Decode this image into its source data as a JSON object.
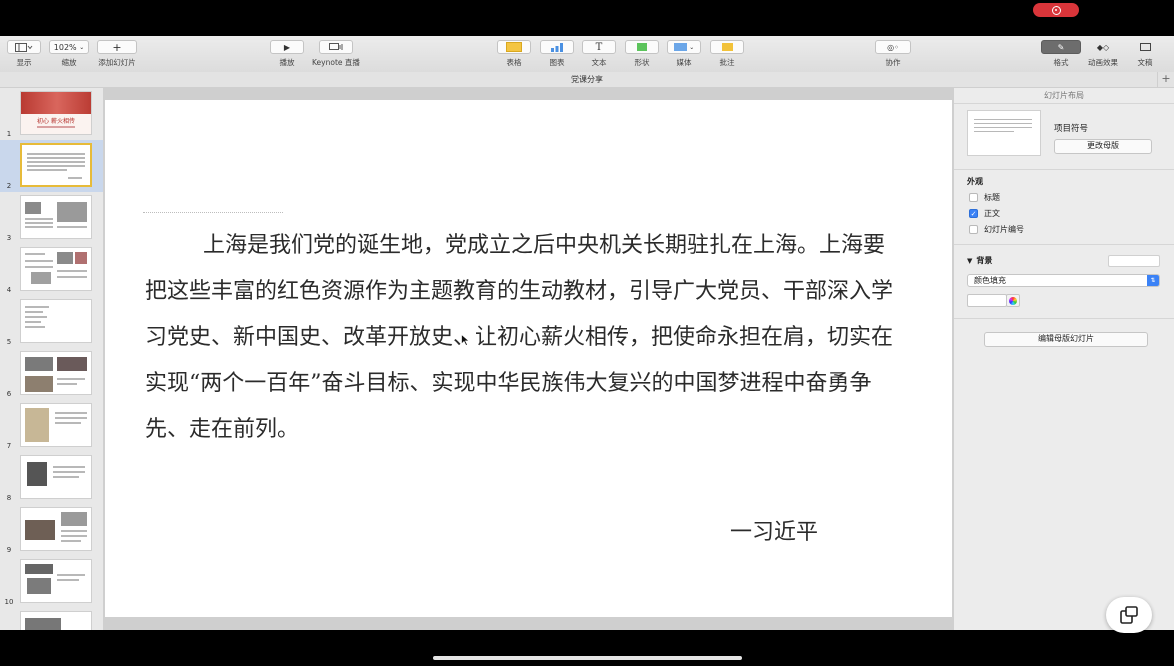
{
  "app": {
    "document_title": "党课分享"
  },
  "toolbar": {
    "view": {
      "label": "显示"
    },
    "zoom": {
      "value": "102%",
      "label": "缩放"
    },
    "add_slide": {
      "label": "添加幻灯片"
    },
    "play": {
      "label": "播放"
    },
    "keynote_live": {
      "label": "Keynote 直播"
    },
    "table": {
      "label": "表格"
    },
    "chart": {
      "label": "图表"
    },
    "text": {
      "label": "文本"
    },
    "shape": {
      "label": "形状"
    },
    "media": {
      "label": "媒体"
    },
    "comment": {
      "label": "批注"
    },
    "collaborate": {
      "label": "协作"
    },
    "format": {
      "label": "格式"
    },
    "animate": {
      "label": "动画效果"
    },
    "document": {
      "label": "文稿"
    }
  },
  "navigator": {
    "slides": [
      {
        "number": "1",
        "title": "初心 薪火相传"
      },
      {
        "number": "2"
      },
      {
        "number": "3"
      },
      {
        "number": "4"
      },
      {
        "number": "5"
      },
      {
        "number": "6"
      },
      {
        "number": "7"
      },
      {
        "number": "8"
      },
      {
        "number": "9"
      },
      {
        "number": "10"
      }
    ],
    "selected": "2"
  },
  "slide": {
    "body": "上海是我们党的诞生地，党成立之后中央机关长期驻扎在上海。上海要把这些丰富的红色资源作为主题教育的生动教材，引导广大党员、干部深入学习党史、新中国史、改革开放史、让初心薪火相传，把使命永担在肩，切实在实现“两个一百年”奋斗目标、实现中华民族伟大复兴的中国梦进程中奋勇争先、走在前列。",
    "author": "一习近平"
  },
  "inspector": {
    "title": "幻灯片布局",
    "layout_name": "项目符号",
    "change_master": "更改母版",
    "appearance": {
      "heading": "外观",
      "title": "标题",
      "body": "正文",
      "slide_number": "幻灯片编号"
    },
    "background": {
      "heading": "背景",
      "fill_type": "颜色填充"
    },
    "edit_master": "编辑母版幻灯片"
  },
  "colors": {
    "accent": "#3b82f6",
    "record": "#d9353a",
    "selection": "#e7bb3a"
  }
}
